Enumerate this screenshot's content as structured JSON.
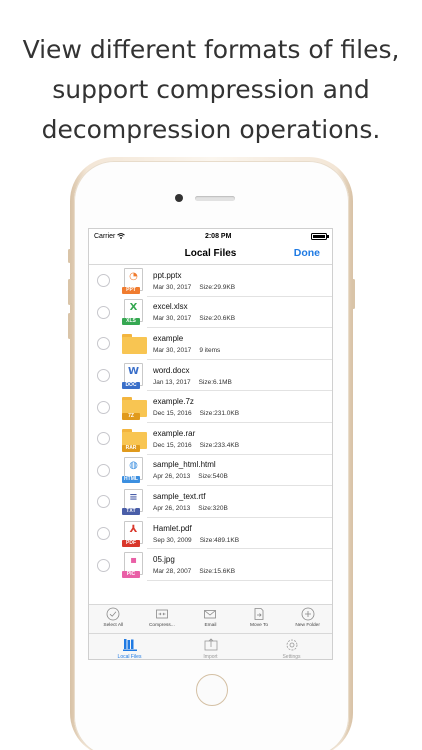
{
  "headline": {
    "line1": "View different formats of files,",
    "line2": "support compression and",
    "line3": "decompression operations."
  },
  "status_bar": {
    "carrier": "Carrier",
    "time": "2:08 PM"
  },
  "nav": {
    "title": "Local Files",
    "done": "Done"
  },
  "files": [
    {
      "name": "ppt.pptx",
      "date": "Mar 30, 2017",
      "size": "Size:29.9KB",
      "type": "PPT",
      "icon": "ppt-file-icon",
      "color": "#f07c2f",
      "glyph": "◔"
    },
    {
      "name": "excel.xlsx",
      "date": "Mar 30, 2017",
      "size": "Size:20.6KB",
      "type": "XLS",
      "icon": "excel-file-icon",
      "color": "#36a852",
      "glyph": "X"
    },
    {
      "name": "example",
      "date": "Mar 30, 2017",
      "size": "9 items",
      "type": "",
      "icon": "folder-icon",
      "color": "#f8c552",
      "glyph": ""
    },
    {
      "name": "word.docx",
      "date": "Jan 13, 2017",
      "size": "Size:6.1MB",
      "type": "DOC",
      "icon": "word-file-icon",
      "color": "#3a6fc9",
      "glyph": "W"
    },
    {
      "name": "example.7z",
      "date": "Dec 15, 2016",
      "size": "Size:231.0KB",
      "type": "7Z",
      "icon": "7z-archive-icon",
      "color": "#e09a1c",
      "glyph": ""
    },
    {
      "name": "example.rar",
      "date": "Dec 15, 2016",
      "size": "Size:233.4KB",
      "type": "RAR",
      "icon": "rar-archive-icon",
      "color": "#e09a1c",
      "glyph": ""
    },
    {
      "name": "sample_html.html",
      "date": "Apr 26, 2013",
      "size": "Size:540B",
      "type": "HTML",
      "icon": "html-file-icon",
      "color": "#3c8fe0",
      "glyph": "◍"
    },
    {
      "name": "sample_text.rtf",
      "date": "Apr 26, 2013",
      "size": "Size:320B",
      "type": "TXT",
      "icon": "text-file-icon",
      "color": "#4a5ea8",
      "glyph": "≡"
    },
    {
      "name": "Hamlet.pdf",
      "date": "Sep 30, 2009",
      "size": "Size:489.1KB",
      "type": "PDF",
      "icon": "pdf-file-icon",
      "color": "#d9372b",
      "glyph": "⅄"
    },
    {
      "name": "05.jpg",
      "date": "Mar 28, 2007",
      "size": "Size:15.6KB",
      "type": "PIC",
      "icon": "image-file-icon",
      "color": "#e95fa6",
      "glyph": "▪"
    }
  ],
  "toolbar": {
    "select_all": "Select All",
    "compress": "Compress...",
    "email": "Email",
    "move_to": "Move To",
    "new_folder": "New Folder"
  },
  "tabs": {
    "local_files": "Local Files",
    "import": "Import",
    "settings": "Settings"
  },
  "colors": {
    "accent": "#1f7ae3",
    "inactive": "#999999"
  }
}
